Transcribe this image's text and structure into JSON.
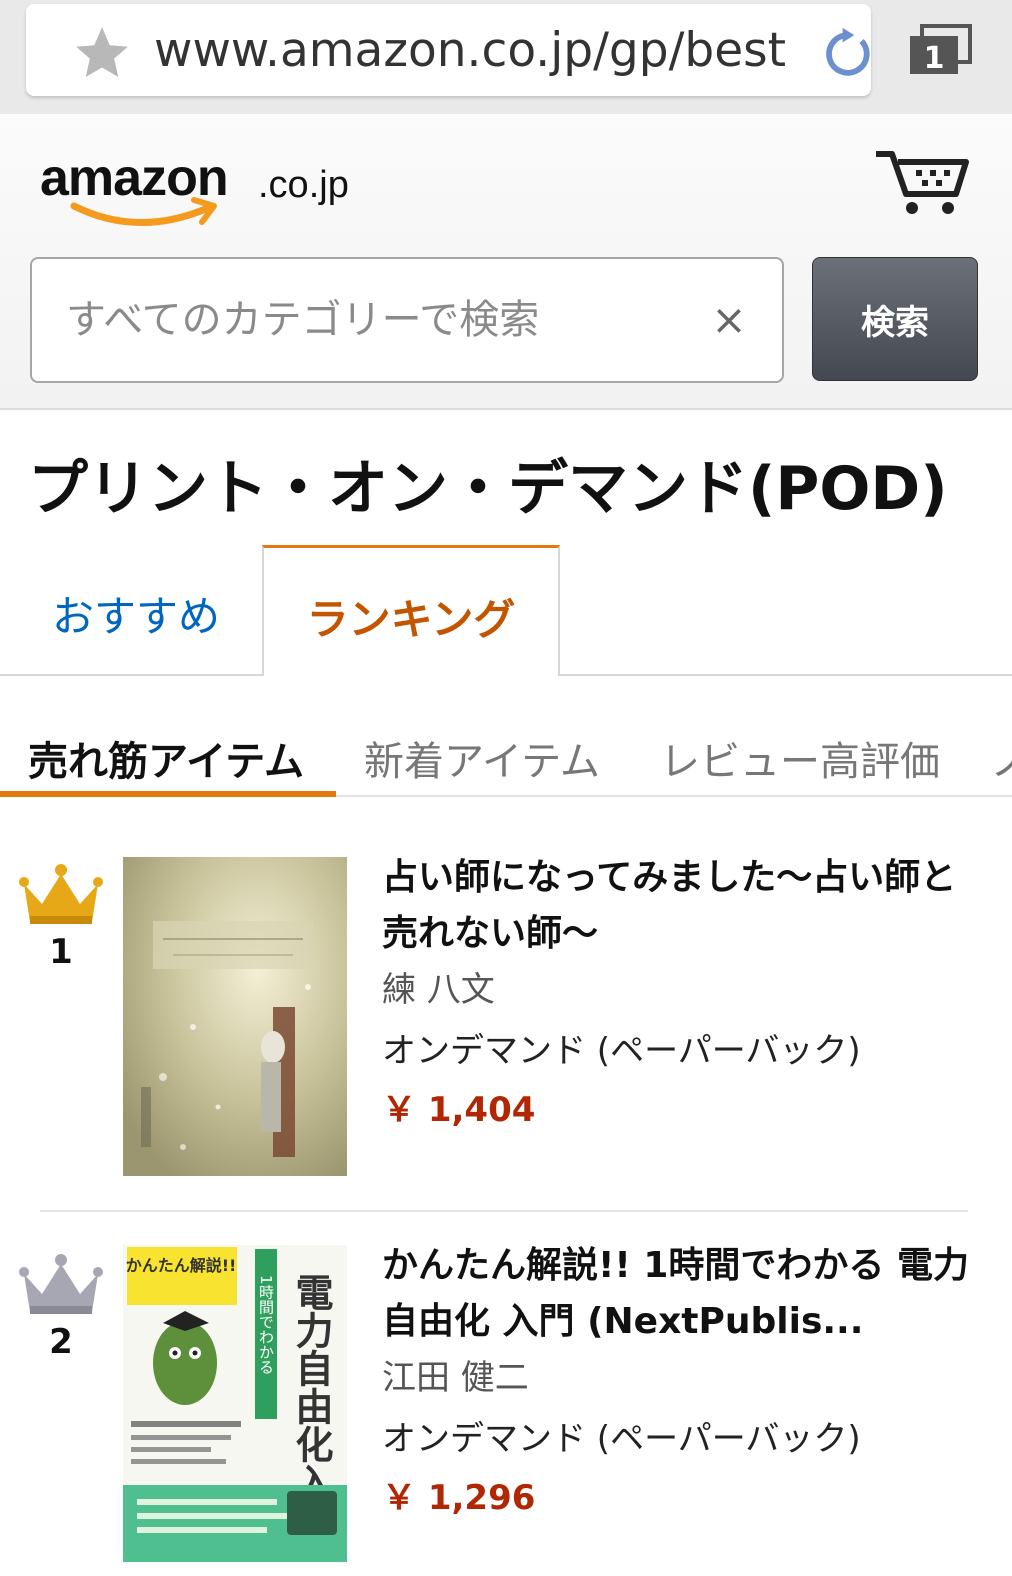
{
  "browser": {
    "url": "www.amazon.co.jp/gp/best",
    "tab_count": "1"
  },
  "header": {
    "logo_word": "amazon",
    "logo_tld": ".co.jp",
    "search_placeholder": "すべてのカテゴリーで検索",
    "clear_symbol": "×",
    "search_button": "検索"
  },
  "page": {
    "title": "プリント・オン・デマンド(POD)",
    "main_tabs": [
      {
        "label": "おすすめ"
      },
      {
        "label": "ランキング",
        "active": true
      }
    ],
    "sub_tabs": [
      {
        "label": "売れ筋アイテム",
        "active": true
      },
      {
        "label": "新着アイテム"
      },
      {
        "label": "レビュー高評価"
      },
      {
        "label": "ノ"
      }
    ]
  },
  "products": [
    {
      "rank": "1",
      "crown": "gold",
      "title": "占い師になってみました〜占い師と売れない師〜",
      "author": "練 八文",
      "format": "オンデマンド (ペーパーバック)",
      "price": "￥ 1,404"
    },
    {
      "rank": "2",
      "crown": "silver",
      "title": "かんたん解説!! 1時間でわかる 電力自由化 入門 (NextPublis...",
      "author": "江田 健二",
      "format": "オンデマンド (ペーパーバック)",
      "price": "￥ 1,296",
      "cover_text": {
        "badge": "かんたん解説!!",
        "side": "1時間でわかる",
        "main": "電力自由化入門"
      }
    }
  ],
  "colors": {
    "accent_orange": "#e47911",
    "link_blue": "#0066c0",
    "price_red": "#b12704",
    "tab_active_text": "#c45500"
  }
}
